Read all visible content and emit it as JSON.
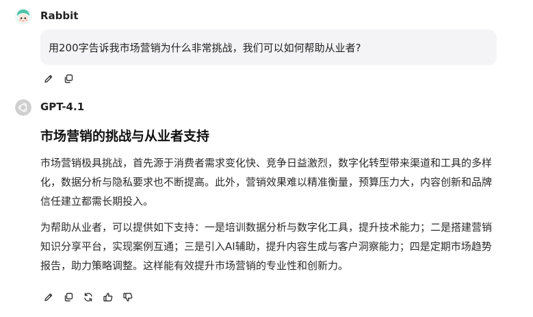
{
  "user": {
    "name": "Rabbit",
    "message": "用200字告诉我市场营销为什么非常挑战，我们可以如何帮助从业者?"
  },
  "assistant": {
    "name": "GPT-4.1",
    "title": "市场营销的挑战与从业者支持",
    "paragraphs": [
      "市场营销极具挑战，首先源于消费者需求变化快、竞争日益激烈，数字化转型带来渠道和工具的多样化，数据分析与隐私要求也不断提高。此外，营销效果难以精准衡量，预算压力大，内容创新和品牌信任建立都需长期投入。",
      "为帮助从业者，可以提供如下支持：一是培训数据分析与数字化工具，提升技术能力；二是搭建营销知识分享平台，实现案例互通；三是引入AI辅助，提升内容生成与客户洞察能力；四是定期市场趋势报告，助力策略调整。这样能有效提升市场营销的专业性和创新力。"
    ]
  },
  "icons": {
    "user_toolbar": [
      "edit-icon",
      "copy-icon"
    ],
    "assistant_toolbar": [
      "edit-icon",
      "copy-icon",
      "regenerate-icon",
      "thumbs-up-icon",
      "thumbs-down-icon"
    ]
  },
  "colors": {
    "bubble_background": "#f4f4f6",
    "avatar_user_hair": "#4cc3a6",
    "avatar_bot_bg": "#cfcfcf"
  }
}
